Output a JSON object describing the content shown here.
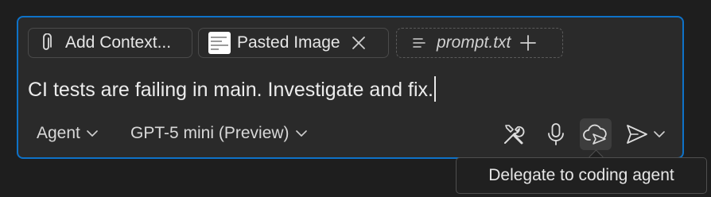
{
  "context_chips": {
    "add_context_label": "Add Context...",
    "pasted_image_label": "Pasted Image",
    "prompt_file_label": "prompt.txt"
  },
  "prompt": {
    "text": "CI tests are failing in main. Investigate and fix."
  },
  "toolbar": {
    "mode_label": "Agent",
    "model_label": "GPT-5 mini (Preview)"
  },
  "tooltip": {
    "text": "Delegate to coding agent"
  },
  "colors": {
    "focus_border": "#0e72c8",
    "panel_background": "#2a2a2a",
    "page_background": "#1e1e1e"
  },
  "icons": [
    "paperclip-icon",
    "close-icon",
    "file-lines-icon",
    "plus-icon",
    "chevron-down-icon",
    "tools-icon",
    "microphone-icon",
    "cloud-delegate-icon",
    "send-icon"
  ]
}
